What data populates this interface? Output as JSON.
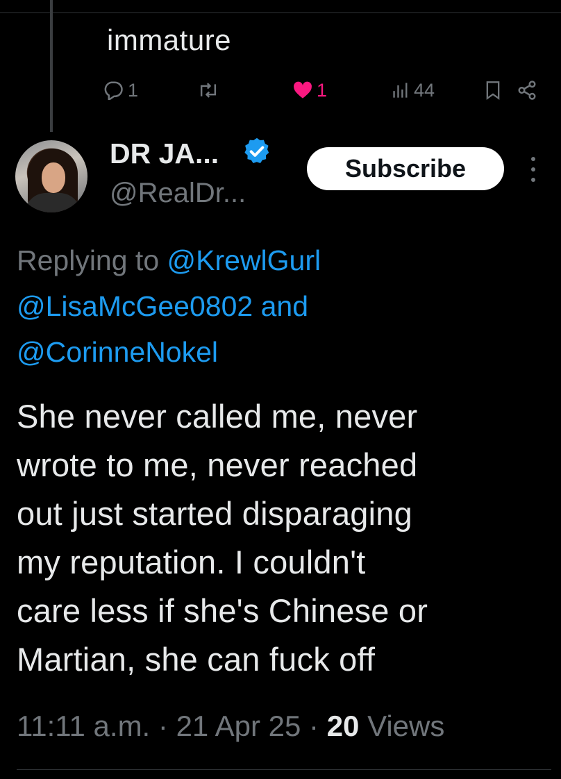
{
  "previous_tweet": {
    "text": "immature",
    "actions": {
      "reply_count": "1",
      "retweet_count": "",
      "like_count": "1",
      "views_count": "44"
    }
  },
  "tweet": {
    "author": {
      "display_name": "DR JA...",
      "handle": "@RealDr...",
      "verified": true
    },
    "subscribe_label": "Subscribe",
    "replying_prefix": "Replying to ",
    "mentions": [
      "@KrewlGurl",
      "@LisaMcGee0802",
      "@CorinneNokel"
    ],
    "mention_joiner": " and",
    "body_lines": [
      "She never called me, never",
      "wrote to me, never reached",
      "out just started disparaging",
      "my reputation. I couldn't",
      "care less if she's Chinese or",
      "Martian, she can fuck off"
    ],
    "time": "11:11 a.m.",
    "separator": " · ",
    "date": "21 Apr 25",
    "views_count": "20",
    "views_label": " Views"
  },
  "colors": {
    "background": "#000000",
    "text": "#e7e9ea",
    "secondary": "#71767b",
    "link": "#1d9bf0",
    "like": "#f91880",
    "verified": "#1d9bf0"
  },
  "icons": {
    "reply": "reply-icon",
    "retweet": "retweet-icon",
    "like": "heart-icon",
    "views": "views-icon",
    "bookmark": "bookmark-icon",
    "share": "share-icon",
    "verified": "verified-badge-icon",
    "more": "more-options-icon"
  }
}
